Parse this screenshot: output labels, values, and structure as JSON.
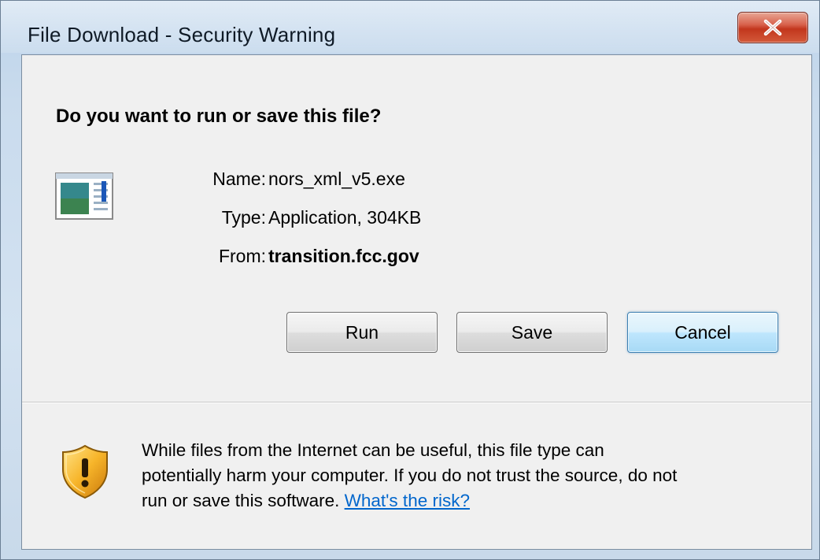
{
  "window": {
    "title": "File Download - Security Warning",
    "close_glyph": "X",
    "colors": {
      "frame": "#c9dbed",
      "client_bg": "#f0f0f0",
      "close_button": "#c2361d",
      "link": "#0066cc"
    }
  },
  "dialog": {
    "heading": "Do you want to run or save this file?",
    "file_icon": "application-window-icon",
    "fields": [
      {
        "label": "Name:",
        "value": "nors_xml_v5.exe"
      },
      {
        "label": "Type:",
        "value": "Application, 304KB"
      },
      {
        "label": "From:",
        "value": "transition.fcc.gov"
      }
    ],
    "buttons": {
      "run": "Run",
      "save": "Save",
      "cancel": "Cancel"
    }
  },
  "warning": {
    "icon": "security-shield-icon",
    "line1": "While files from the Internet can be useful, this file type can",
    "line2": "potentially harm your computer. If you do not trust the source, do not",
    "line3_prefix": "run or save this software.",
    "link_text": "What's the risk?"
  }
}
